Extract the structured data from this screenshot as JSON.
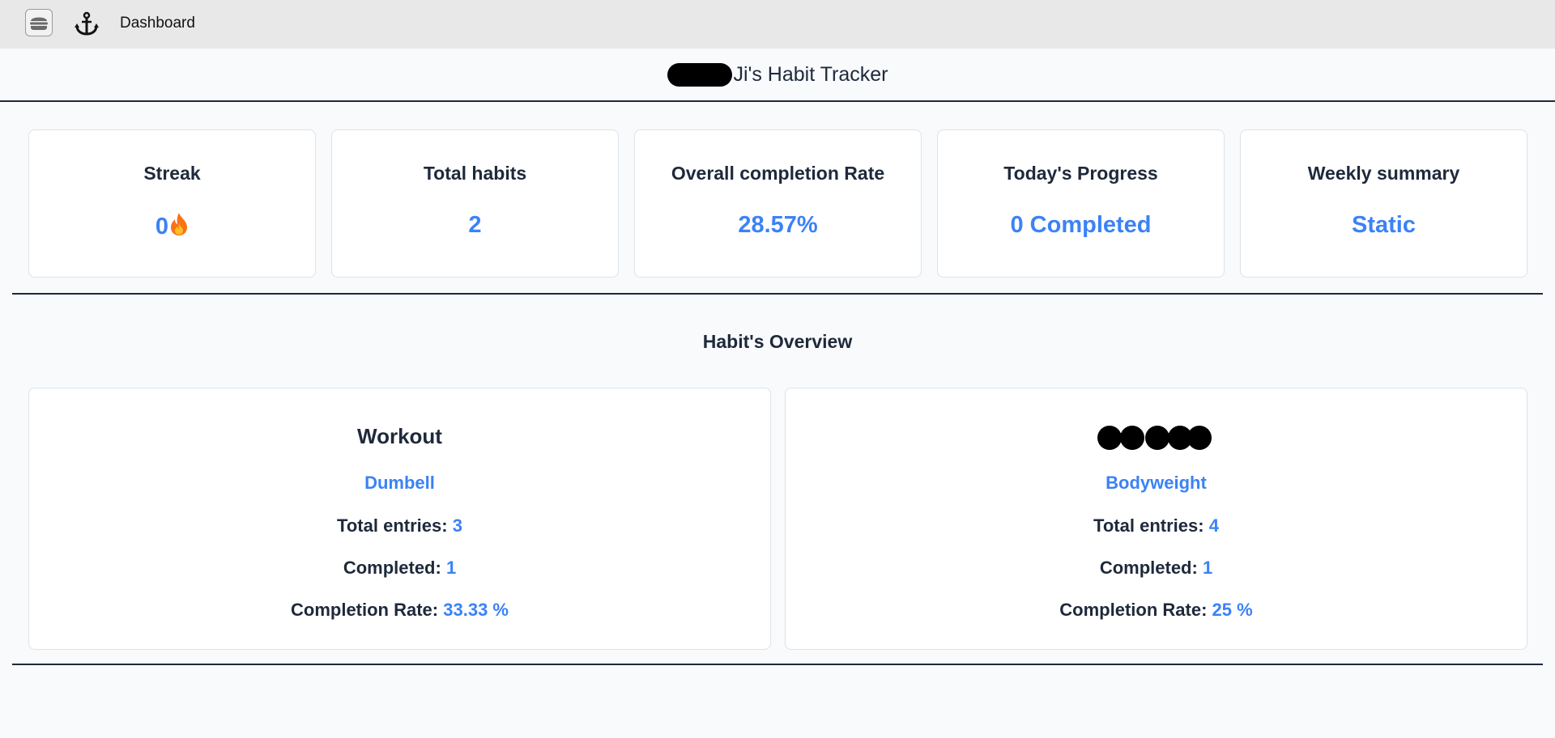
{
  "topbar": {
    "brand": "Dashboard",
    "menu_icon": "hamburger-icon",
    "logo_icon": "anchor-icon"
  },
  "header": {
    "title": "Ji's Habit Tracker"
  },
  "stats": [
    {
      "label": "Streak",
      "value": "0",
      "icon": "fire-icon"
    },
    {
      "label": "Total habits",
      "value": "2"
    },
    {
      "label": "Overall completion Rate",
      "value": "28.57%"
    },
    {
      "label": "Today's Progress",
      "value": "0 Completed"
    },
    {
      "label": "Weekly summary",
      "value": "Static"
    }
  ],
  "overview": {
    "title": "Habit's Overview",
    "labels": {
      "total_entries": "Total entries:",
      "completed": "Completed:",
      "completion_rate": "Completion Rate:"
    },
    "habits": [
      {
        "name": "Workout",
        "type": "Dumbell",
        "total_entries": "3",
        "completed": "1",
        "completion_rate": "33.33 %"
      },
      {
        "name": "",
        "type": "Bodyweight",
        "total_entries": "4",
        "completed": "1",
        "completion_rate": "25 %"
      }
    ]
  },
  "colors": {
    "accent": "#3b82f6",
    "text": "#1e293b",
    "topbar": "#e8e8e8",
    "page": "#f8fafc"
  }
}
